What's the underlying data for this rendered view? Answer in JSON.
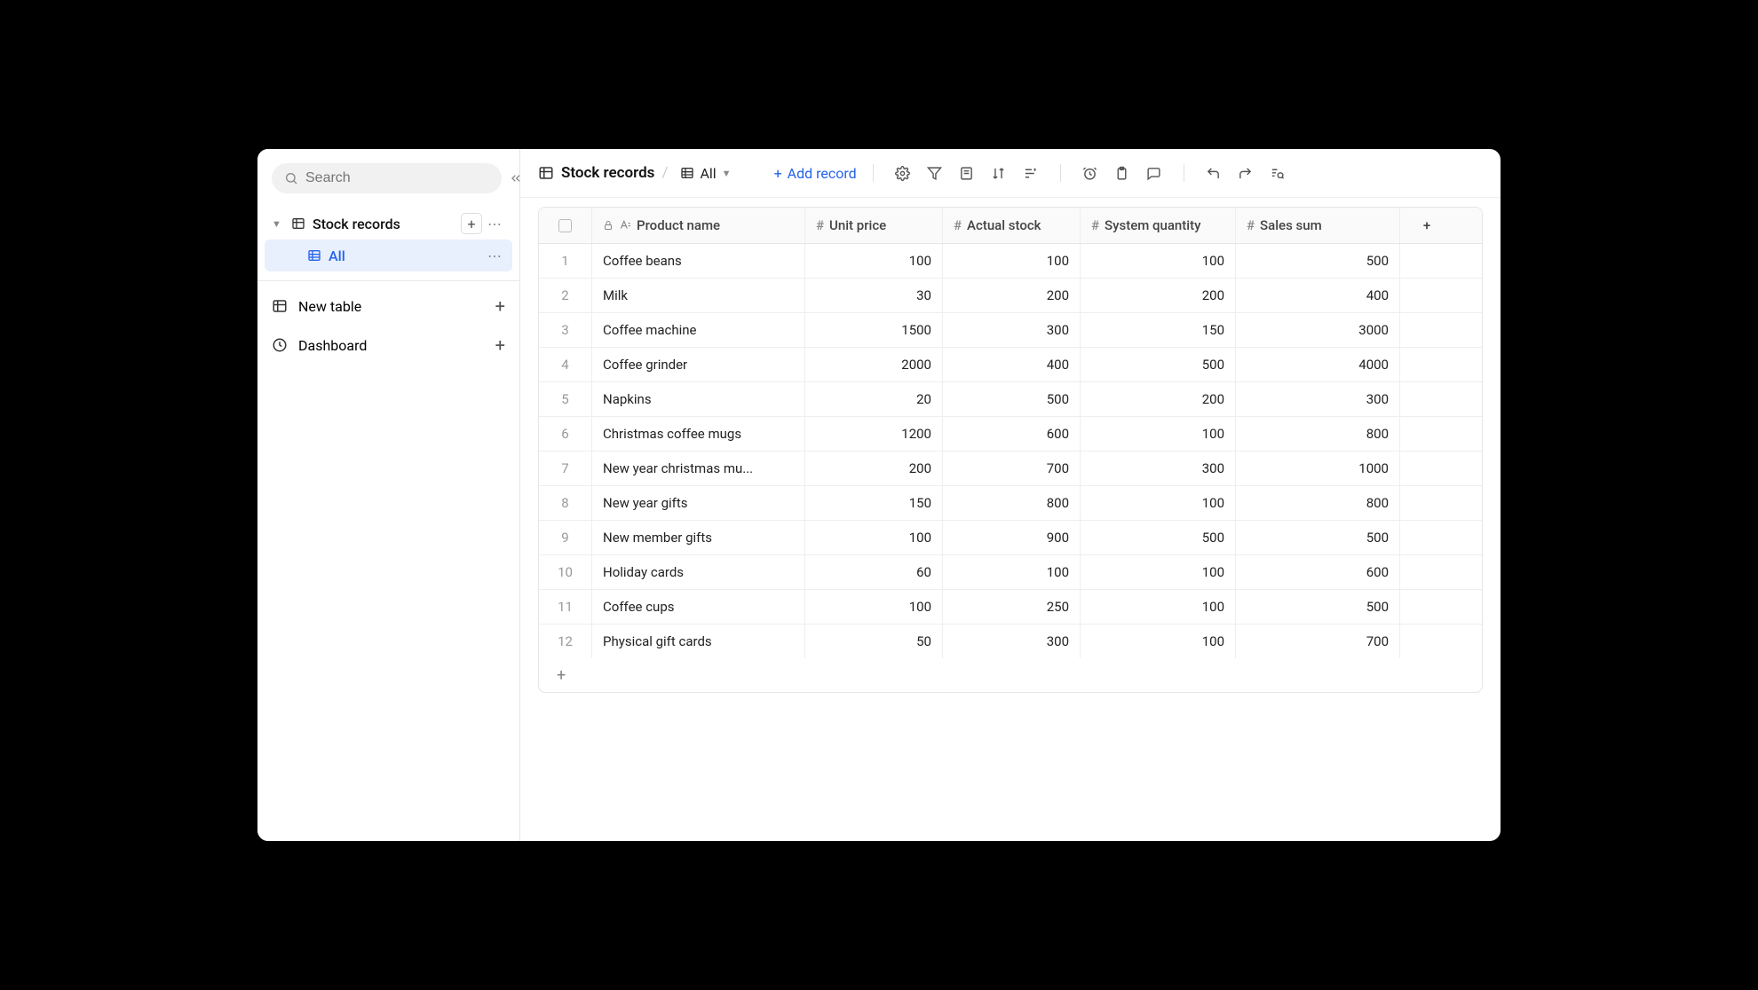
{
  "sidebar": {
    "search_placeholder": "Search",
    "table_name": "Stock records",
    "view_name": "All",
    "new_table_label": "New table",
    "dashboard_label": "Dashboard"
  },
  "toolbar": {
    "table_title": "Stock records",
    "view_label": "All",
    "add_record_label": "Add record"
  },
  "table": {
    "columns": [
      {
        "label": "Product name",
        "type": "text"
      },
      {
        "label": "Unit price",
        "type": "number"
      },
      {
        "label": "Actual stock",
        "type": "number"
      },
      {
        "label": "System quantity",
        "type": "number"
      },
      {
        "label": "Sales sum",
        "type": "number"
      }
    ],
    "rows": [
      {
        "n": "1",
        "name": "Coffee beans",
        "c1": "100",
        "c2": "100",
        "c3": "100",
        "c4": "500"
      },
      {
        "n": "2",
        "name": "Milk",
        "c1": "30",
        "c2": "200",
        "c3": "200",
        "c4": "400"
      },
      {
        "n": "3",
        "name": "Coffee machine",
        "c1": "1500",
        "c2": "300",
        "c3": "150",
        "c4": "3000"
      },
      {
        "n": "4",
        "name": "Coffee grinder",
        "c1": "2000",
        "c2": "400",
        "c3": "500",
        "c4": "4000"
      },
      {
        "n": "5",
        "name": "Napkins",
        "c1": "20",
        "c2": "500",
        "c3": "200",
        "c4": "300"
      },
      {
        "n": "6",
        "name": "Christmas coffee mugs",
        "c1": "1200",
        "c2": "600",
        "c3": "100",
        "c4": "800"
      },
      {
        "n": "7",
        "name": "New year christmas mu...",
        "c1": "200",
        "c2": "700",
        "c3": "300",
        "c4": "1000"
      },
      {
        "n": "8",
        "name": "New year gifts",
        "c1": "150",
        "c2": "800",
        "c3": "100",
        "c4": "800"
      },
      {
        "n": "9",
        "name": "New member gifts",
        "c1": "100",
        "c2": "900",
        "c3": "500",
        "c4": "500"
      },
      {
        "n": "10",
        "name": "Holiday cards",
        "c1": "60",
        "c2": "100",
        "c3": "100",
        "c4": "600"
      },
      {
        "n": "11",
        "name": "Coffee cups",
        "c1": "100",
        "c2": "250",
        "c3": "100",
        "c4": "500"
      },
      {
        "n": "12",
        "name": "Physical gift cards",
        "c1": "50",
        "c2": "300",
        "c3": "100",
        "c4": "700"
      }
    ]
  }
}
